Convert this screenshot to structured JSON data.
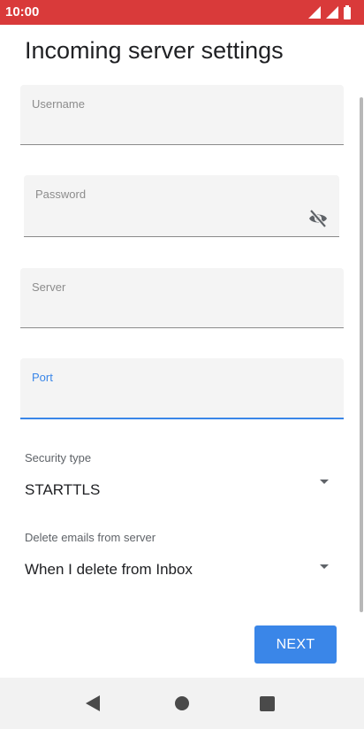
{
  "status_bar": {
    "time": "10:00",
    "background_color": "#d93a3a",
    "icons": [
      "signal-icon",
      "signal-icon",
      "battery-icon"
    ]
  },
  "page": {
    "title": "Incoming server settings"
  },
  "fields": {
    "username": {
      "label": "Username",
      "value": ""
    },
    "password": {
      "label": "Password",
      "value": "",
      "toggle_icon": "visibility-off-icon"
    },
    "server": {
      "label": "Server",
      "value": ""
    },
    "port": {
      "label": "Port",
      "value": "",
      "focused": true,
      "accent_color": "#3a86e8"
    }
  },
  "security_type": {
    "label": "Security type",
    "selected": "STARTTLS"
  },
  "delete_emails": {
    "label": "Delete emails from server",
    "selected": "When I delete from Inbox"
  },
  "actions": {
    "next_label": "NEXT",
    "accent_color": "#3a86e8"
  },
  "nav_bar": {
    "icons": [
      "back-icon",
      "home-icon",
      "recents-icon"
    ]
  }
}
